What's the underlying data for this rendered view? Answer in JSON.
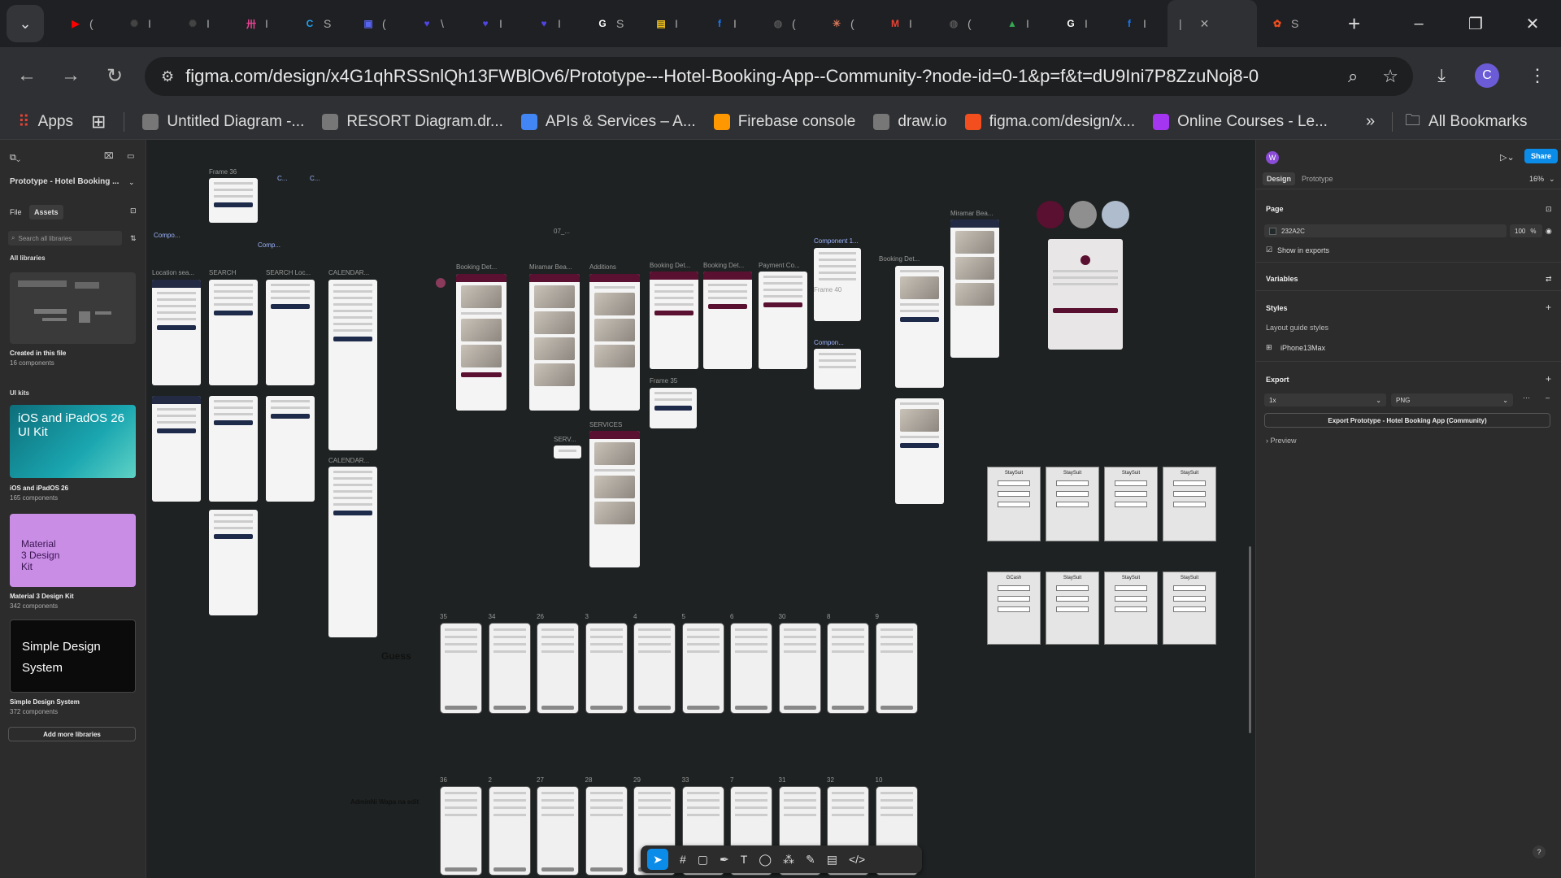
{
  "browser": {
    "tabs": [
      {
        "icon": "youtube-icon",
        "color": "#ff0000",
        "glyph": "▶",
        "label": "("
      },
      {
        "icon": "chatgpt-icon",
        "color": "#444444",
        "glyph": "✺",
        "label": "I"
      },
      {
        "icon": "chatgpt-icon",
        "color": "#444444",
        "glyph": "✺",
        "label": "I"
      },
      {
        "icon": "app-icon",
        "color": "#e84393",
        "glyph": "卅",
        "label": "I"
      },
      {
        "icon": "canva-icon",
        "color": "#1da1f2",
        "glyph": "C",
        "label": "S"
      },
      {
        "icon": "app-icon",
        "color": "#5865f2",
        "glyph": "▣",
        "label": "("
      },
      {
        "icon": "heart-icon",
        "color": "#4f46e5",
        "glyph": "♥",
        "label": "\\"
      },
      {
        "icon": "heart-icon",
        "color": "#4f46e5",
        "glyph": "♥",
        "label": "I"
      },
      {
        "icon": "heart-icon",
        "color": "#4f46e5",
        "glyph": "♥",
        "label": "I"
      },
      {
        "icon": "google-icon",
        "color": "#ffffff",
        "glyph": "G",
        "label": "S"
      },
      {
        "icon": "course-icon",
        "color": "#f5c518",
        "glyph": "▤",
        "label": "I"
      },
      {
        "icon": "facebook-icon",
        "color": "#1877f2",
        "glyph": "f",
        "label": "I"
      },
      {
        "icon": "globe-icon",
        "color": "#555555",
        "glyph": "◍",
        "label": "("
      },
      {
        "icon": "claude-icon",
        "color": "#d97757",
        "glyph": "✳",
        "label": "("
      },
      {
        "icon": "gmail-icon",
        "color": "#ea4335",
        "glyph": "M",
        "label": "I"
      },
      {
        "icon": "globe-icon",
        "color": "#555555",
        "glyph": "◍",
        "label": "("
      },
      {
        "icon": "drive-icon",
        "color": "#34a853",
        "glyph": "▲",
        "label": "I"
      },
      {
        "icon": "google-icon",
        "color": "#ffffff",
        "glyph": "G",
        "label": "I"
      },
      {
        "icon": "facebook-icon",
        "color": "#1877f2",
        "glyph": "f",
        "label": "I"
      },
      {
        "icon": "figma-icon",
        "color": "#f24e1e",
        "glyph": "✿",
        "label": "S"
      }
    ],
    "url": "figma.com/design/x4G1qhRSSnlQh13FWBlOv6/Prototype---Hotel-Booking-App--Community-?node-id=0-1&p=f&t=dU9Ini7P8ZzuNoj8-0",
    "avatar_letter": "C",
    "bookmarks": [
      {
        "label": "Apps",
        "color": "#ea4335"
      },
      {
        "label": "Untitled Diagram -...",
        "color": "#777777"
      },
      {
        "label": "RESORT Diagram.dr...",
        "color": "#777777"
      },
      {
        "label": "APIs & Services – A...",
        "color": "#4285f4"
      },
      {
        "label": "Firebase console",
        "color": "#ff9800"
      },
      {
        "label": "draw.io",
        "color": "#777777"
      },
      {
        "label": "figma.com/design/x...",
        "color": "#f24e1e"
      },
      {
        "label": "Online Courses - Le...",
        "color": "#a435f0"
      }
    ],
    "all_bookmarks": "All Bookmarks"
  },
  "left_panel": {
    "file_name": "Prototype - Hotel Booking ...",
    "tab_file": "File",
    "tab_assets": "Assets",
    "search_placeholder": "Search all libraries",
    "all_libraries": "All libraries",
    "created_title": "Created in this file",
    "created_count": "16 components",
    "ui_kits": "UI kits",
    "libraries": [
      {
        "card": "iOS and iPadOS 26 UI Kit",
        "title": "iOS and iPadOS 26",
        "count": "165 components"
      },
      {
        "card": "Material 3 Design Kit",
        "title": "Material 3 Design Kit",
        "count": "342 components"
      },
      {
        "card": "Simple Design System",
        "title": "Simple Design System",
        "count": "372 components"
      }
    ],
    "add_more": "Add more libraries"
  },
  "canvas": {
    "labels": {
      "frame36": "Frame 36",
      "compo1": "Compo...",
      "compo2": "Comp...",
      "c1": "C...",
      "c2": "C...",
      "location": "Location sea...",
      "search": "SEARCH",
      "search_loc": "SEARCH Loc...",
      "calendar": "CALENDAR...",
      "calendar2": "CALENDAR...",
      "booking1": "Booking Det...",
      "miramar": "Miramar Bea...",
      "additions": "Additions",
      "booking2": "Booking Det...",
      "booking3": "Booking Det...",
      "payment": "Payment Co...",
      "component1": "Component 1...",
      "component2": "Compon...",
      "booking4": "Booking Det...",
      "miramar2": "Miramar Bea...",
      "frame35": "Frame 35",
      "frame40": "Frame 40",
      "services": "SERVICES",
      "serv": "SERV...",
      "p07": "07_...",
      "guess": "Guess",
      "admin": "AdminNi Wapa na edit",
      "row1_nums": [
        "35",
        "34",
        "26",
        "3",
        "4",
        "5",
        "6",
        "30",
        "8",
        "9"
      ],
      "row2_nums": [
        "36",
        "2",
        "27",
        "28",
        "29",
        "33",
        "7",
        "31",
        "32",
        "10"
      ]
    },
    "swatches": [
      "#5a1030",
      "#8f8f8f",
      "#aebccd"
    ],
    "wire_titles": [
      "StaySuit",
      "StaySuit",
      "StaySuit",
      "StaySuit",
      "GCash",
      "StaySuit",
      "StaySuit",
      "StaySuit"
    ]
  },
  "right_panel": {
    "user_letter": "W",
    "share": "Share",
    "tab_design": "Design",
    "tab_prototype": "Prototype",
    "zoom": "16%",
    "page_header": "Page",
    "page_color": "232A2C",
    "page_opacity": "100",
    "page_opacity_unit": "%",
    "show_in_exports": "Show in exports",
    "variables": "Variables",
    "styles": "Styles",
    "layout_guide_styles": "Layout guide styles",
    "layout_item": "iPhone13Max",
    "export_header": "Export",
    "export_scale": "1x",
    "export_format": "PNG",
    "export_button": "Export Prototype - Hotel Booking App (Community)",
    "preview": "Preview"
  }
}
